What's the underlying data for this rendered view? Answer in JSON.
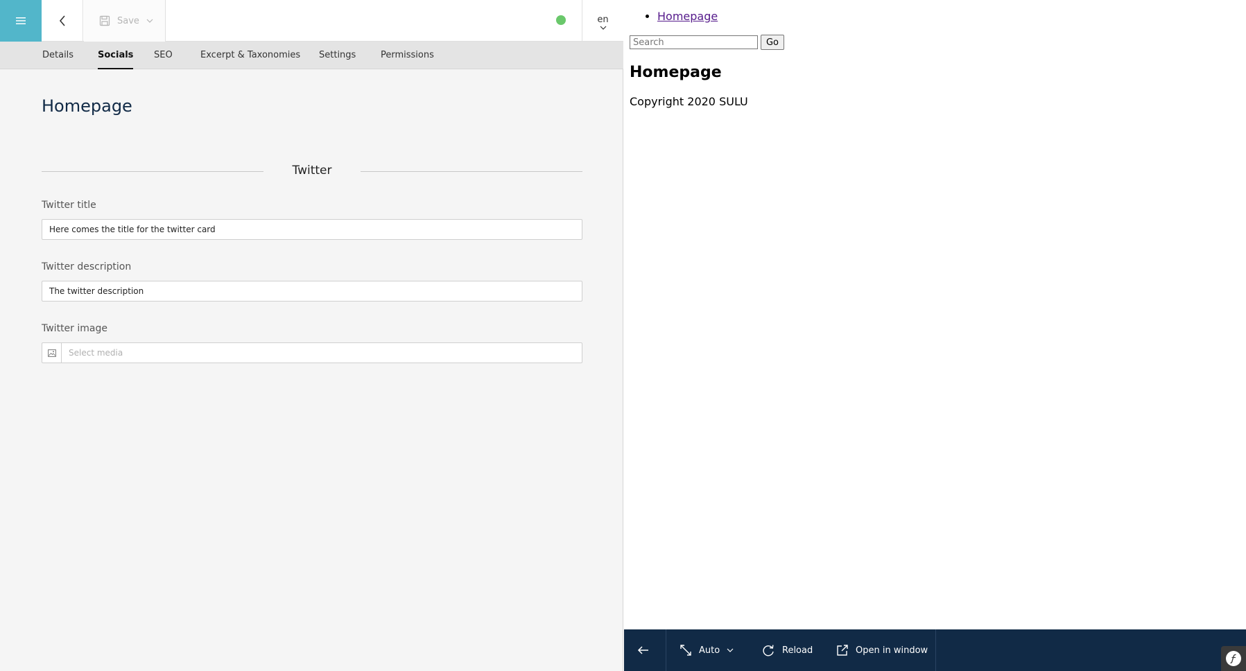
{
  "toolbar": {
    "save_label": "Save",
    "locale": "en"
  },
  "tabs": [
    {
      "label": "Details"
    },
    {
      "label": "Socials"
    },
    {
      "label": "SEO"
    },
    {
      "label": "Excerpt & Taxonomies"
    },
    {
      "label": "Settings"
    },
    {
      "label": "Permissions"
    }
  ],
  "active_tab": "Socials",
  "page_title": "Homepage",
  "section_title": "Twitter",
  "fields": {
    "title": {
      "label": "Twitter title",
      "value": "Here comes the title for the twitter card"
    },
    "description": {
      "label": "Twitter description",
      "value": "The twitter description"
    },
    "image": {
      "label": "Twitter image",
      "placeholder": "Select media"
    }
  },
  "preview": {
    "nav_link": "Homepage",
    "search_placeholder": "Search",
    "go_label": "Go",
    "heading": "Homepage",
    "copyright": "Copyright 2020 SULU"
  },
  "preview_toolbar": {
    "device_label": "Auto",
    "reload_label": "Reload",
    "open_label": "Open in window"
  },
  "colors": {
    "accent": "#52b6ca",
    "status_published": "#6ac86b",
    "preview_toolbar_bg": "#112a46"
  }
}
